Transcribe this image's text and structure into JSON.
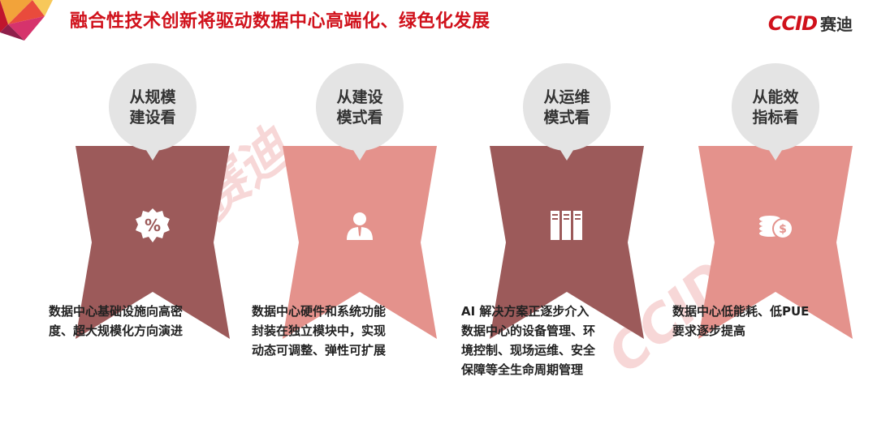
{
  "header": {
    "title": "融合性技术创新将驱动数据中心高端化、绿色化发展",
    "logo_mark": "CCID",
    "logo_cn": "赛迪"
  },
  "colors": {
    "accent": "#d0111b",
    "dark_ribbon": "#9c5a5a",
    "light_ribbon": "#e4928c",
    "bubble": "#e4e4e4"
  },
  "watermark": "CCID赛迪",
  "cards": [
    {
      "heading_line1": "从规模",
      "heading_line2": "建设看",
      "icon": "percent-icon",
      "ribbon_color": "#9c5a5a",
      "desc_lines": [
        "数据中心基础设施向高密",
        "度、超大规模化方向演进"
      ]
    },
    {
      "heading_line1": "从建设",
      "heading_line2": "模式看",
      "icon": "person-icon",
      "ribbon_color": "#e4928c",
      "desc_lines": [
        "数据中心硬件和系统功能",
        "封装在独立模块中，实现",
        "动态可调整、弹性可扩展"
      ]
    },
    {
      "heading_line1": "从运维",
      "heading_line2": "模式看",
      "icon": "server-rack-icon",
      "ribbon_color": "#9c5a5a",
      "desc_lines": [
        "AI 解决方案正逐步介入",
        "数据中心的设备管理、环",
        "境控制、现场运维、安全",
        "保障等全生命周期管理"
      ]
    },
    {
      "heading_line1": "从能效",
      "heading_line2": "指标看",
      "icon": "coins-icon",
      "ribbon_color": "#e4928c",
      "desc_lines": [
        "数据中心低能耗、低PUE",
        "要求逐步提高"
      ]
    }
  ]
}
